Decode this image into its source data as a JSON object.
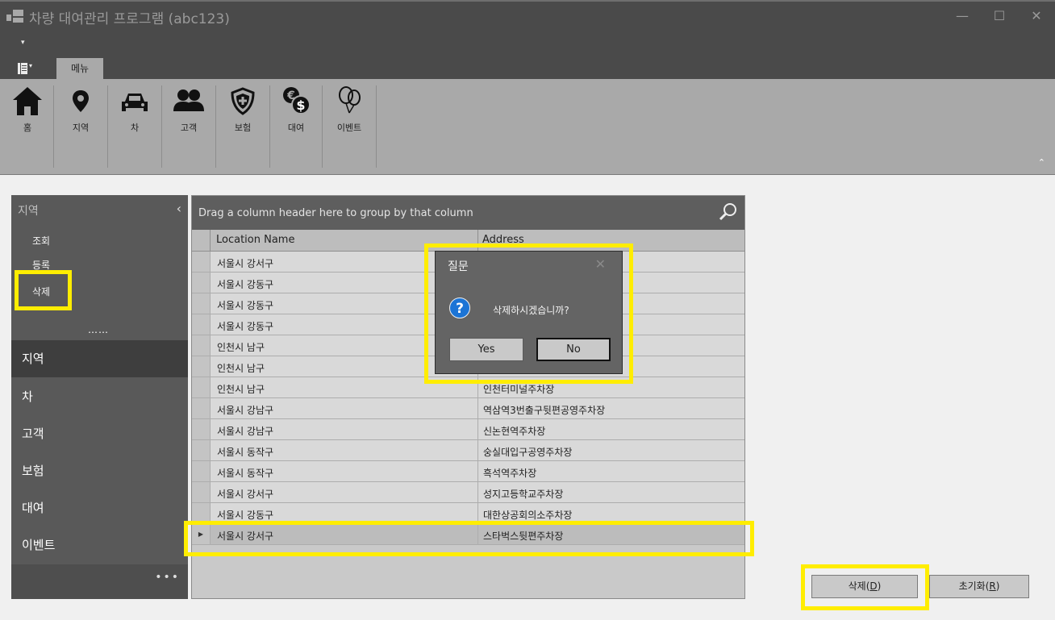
{
  "window": {
    "title": "차량 대여관리 프로그램 (abc123)",
    "controls": {
      "minimize": "—",
      "maximize": "☐",
      "close": "✕"
    }
  },
  "quick_access": {
    "arrow": "▾"
  },
  "ribbon": {
    "app_menu_arrow": "▾",
    "tab": "메뉴",
    "buttons": [
      {
        "label": "홈",
        "icon": "home-icon"
      },
      {
        "label": "지역",
        "icon": "location-pin-icon"
      },
      {
        "label": "차",
        "icon": "car-icon"
      },
      {
        "label": "고객",
        "icon": "customers-icon"
      },
      {
        "label": "보험",
        "icon": "shield-icon"
      },
      {
        "label": "대여",
        "icon": "money-icon"
      },
      {
        "label": "이벤트",
        "icon": "balloons-icon"
      }
    ],
    "collapse_glyph": "⌃"
  },
  "nav": {
    "header": "지역",
    "header_glyph": "‹",
    "sub_items": [
      "조회",
      "등록",
      "삭제"
    ],
    "more_dots": "……",
    "groups": [
      "지역",
      "차",
      "고객",
      "보험",
      "대여",
      "이벤트"
    ],
    "footer_glyph": "•••"
  },
  "grid": {
    "group_panel_text": "Drag a column header here to group by that column",
    "columns": [
      "Location Name",
      "Address"
    ],
    "current_row_glyph": "▶",
    "rows": [
      {
        "location": "서울시 강서구",
        "address": ""
      },
      {
        "location": "서울시 강동구",
        "address": ""
      },
      {
        "location": "서울시 강동구",
        "address": ""
      },
      {
        "location": "서울시 강동구",
        "address": ""
      },
      {
        "location": "인천시 남구",
        "address": ""
      },
      {
        "location": "인천시 남구",
        "address": ""
      },
      {
        "location": "인천시 남구",
        "address": "인천터미널주차장"
      },
      {
        "location": "서울시 강남구",
        "address": "역삼역3번출구뒷편공영주차장"
      },
      {
        "location": "서울시 강남구",
        "address": "신논현역주차장"
      },
      {
        "location": "서울시 동작구",
        "address": "숭실대입구공영주차장"
      },
      {
        "location": "서울시 동작구",
        "address": "흑석역주차장"
      },
      {
        "location": "서울시 강서구",
        "address": "성지고등학교주차장"
      },
      {
        "location": "서울시 강동구",
        "address": "대한상공회의소주차장"
      },
      {
        "location": "서울시 강서구",
        "address": "스타벅스뒷편주차장"
      }
    ],
    "selected_row_index": 13
  },
  "actions": {
    "delete_label": "삭제(D)",
    "reset_label": "초기화(R)"
  },
  "dialog": {
    "title": "질문",
    "close_glyph": "✕",
    "icon_glyph": "?",
    "message": "삭제하시겠습니까?",
    "yes_label": "Yes",
    "no_label": "No"
  },
  "colors": {
    "highlight": "#ffed00",
    "question_icon": "#1b74d6",
    "chrome_dark": "#4a4a4a",
    "ribbon": "#a9a9a9"
  }
}
